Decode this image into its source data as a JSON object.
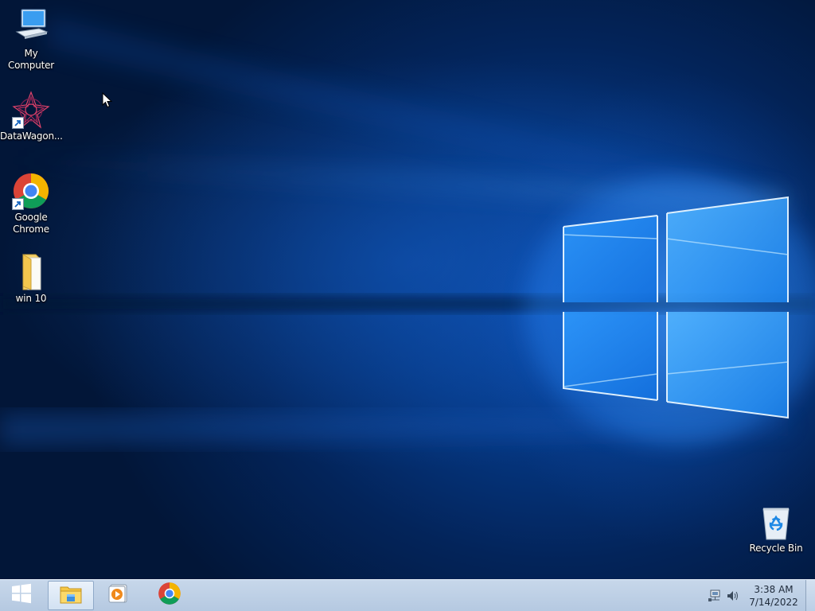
{
  "desktop": {
    "icons": [
      {
        "label": "My Computer",
        "icon": "computer-icon"
      },
      {
        "label": "DataWagon...",
        "icon": "datawagon-icon",
        "shortcut": true
      },
      {
        "label": "Google Chrome",
        "icon": "chrome-icon",
        "shortcut": true
      },
      {
        "label": "win 10",
        "icon": "folder-icon"
      },
      {
        "label": "Recycle Bin",
        "icon": "recycle-bin-icon"
      }
    ]
  },
  "taskbar": {
    "start": {
      "icon": "windows-logo-icon"
    },
    "pinned": [
      {
        "name": "File Explorer",
        "icon": "file-explorer-icon",
        "active": true
      },
      {
        "name": "Media Player",
        "icon": "media-player-icon",
        "active": false
      },
      {
        "name": "Google Chrome",
        "icon": "chrome-icon",
        "active": false
      }
    ],
    "tray": {
      "icons": [
        "network-icon",
        "volume-icon"
      ],
      "time": "3:38 AM",
      "date": "7/14/2022"
    }
  },
  "colors": {
    "taskbar": "#b9cde4",
    "wallpaper_accent": "#1f8fff"
  }
}
